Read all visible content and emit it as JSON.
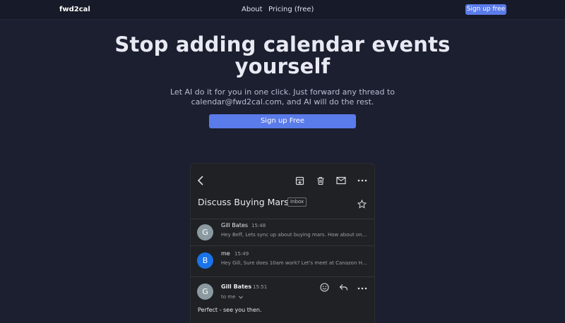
{
  "nav": {
    "brand": "fwd2cal",
    "links": [
      "About",
      "Pricing (free)"
    ],
    "cta": "Sign up free"
  },
  "hero": {
    "title": "Stop adding calendar events yourself",
    "subtitle": "Let AI do it for you in one click. Just forward any thread to calendar@fwd2cal.com, and AI will do the rest.",
    "cta": "Sign up Free"
  },
  "email_preview": {
    "subject": "Discuss Buying Mars",
    "label": "Inbox",
    "toolbar_icons": [
      "back-arrow-icon",
      "archive-icon",
      "trash-icon",
      "mark-unread-icon",
      "more-icon"
    ],
    "messages": [
      {
        "avatar": "G",
        "avatar_color": "#8a9aa0",
        "sender": "Gill Bates",
        "time": "15:48",
        "snippet": "Hey Beff, Lets sync up about buying mars. How about on..."
      },
      {
        "avatar": "B",
        "avatar_color": "#1a73e8",
        "sender": "me",
        "time": "15:49",
        "snippet": "Hey Gill, Sure does 10am work? Let's meet at Canazon H..."
      },
      {
        "avatar": "G",
        "avatar_color": "#8a9aa0",
        "sender": "Gill Bates",
        "time": "15:51",
        "recipient": "to me",
        "body": "Perfect - see you then."
      }
    ]
  },
  "colors": {
    "page_background": "#1b1f30",
    "accent": "#5a7bea",
    "mail_background": "#202124"
  }
}
